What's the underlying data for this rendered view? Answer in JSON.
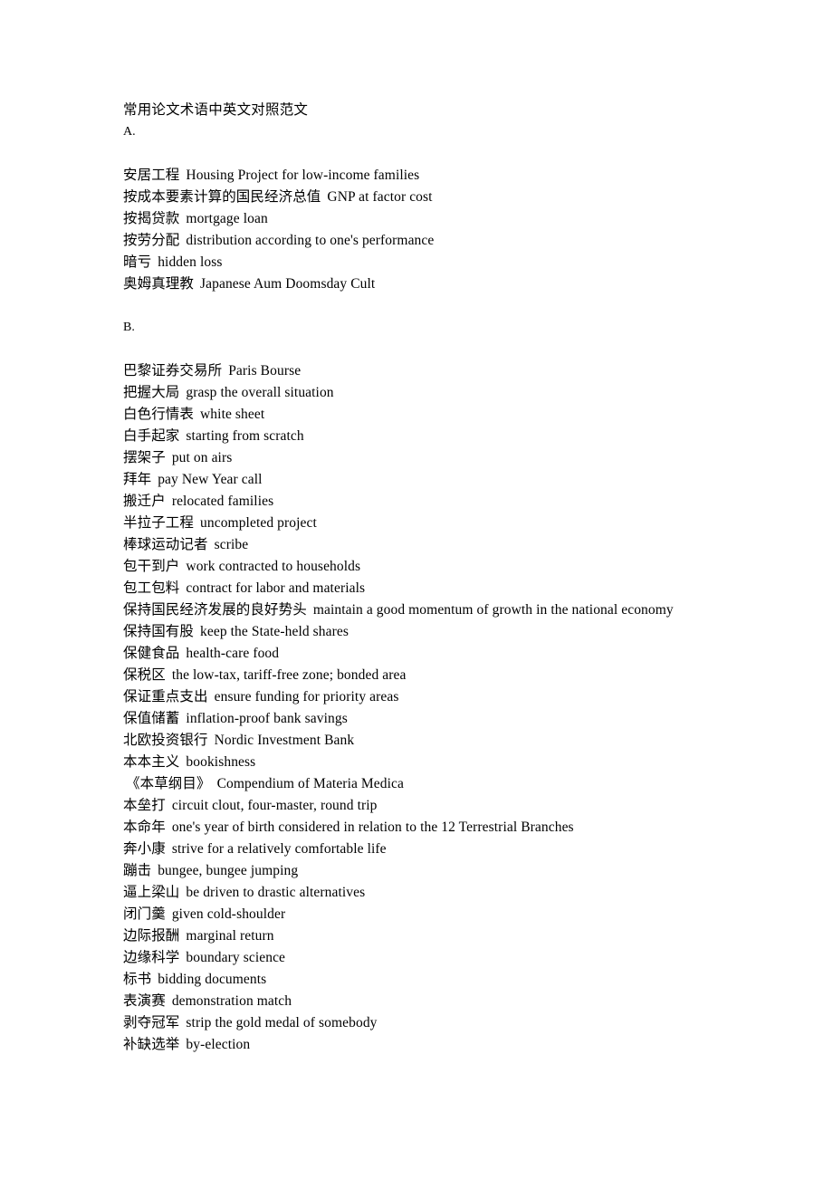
{
  "document": {
    "title": "常用论文术语中英文对照范文",
    "background_color": "#ffffff",
    "text_color": "#000000"
  },
  "sections": [
    {
      "letter": "A.",
      "entries": [
        {
          "term": "安居工程",
          "gloss": "Housing Project for low-income families"
        },
        {
          "term": "按成本要素计算的国民经济总值",
          "gloss": "GNP at factor cost"
        },
        {
          "term": "按揭贷款",
          "gloss": "mortgage loan"
        },
        {
          "term": "按劳分配",
          "gloss": "distribution according to one's performance"
        },
        {
          "term": "暗亏",
          "gloss": "hidden loss"
        },
        {
          "term": "奥姆真理教",
          "gloss": "Japanese Aum Doomsday Cult"
        }
      ]
    },
    {
      "letter": "B.",
      "entries": [
        {
          "term": "巴黎证券交易所",
          "gloss": "Paris Bourse"
        },
        {
          "term": "把握大局",
          "gloss": "grasp the overall situation"
        },
        {
          "term": "白色行情表",
          "gloss": "white sheet"
        },
        {
          "term": "白手起家",
          "gloss": "starting from scratch"
        },
        {
          "term": "摆架子",
          "gloss": "put on airs"
        },
        {
          "term": "拜年",
          "gloss": "pay New Year call"
        },
        {
          "term": "搬迁户",
          "gloss": "relocated families"
        },
        {
          "term": "半拉子工程",
          "gloss": "uncompleted project"
        },
        {
          "term": "棒球运动记者",
          "gloss": "scribe"
        },
        {
          "term": "包干到户",
          "gloss": "work contracted to households"
        },
        {
          "term": "包工包料",
          "gloss": "contract for labor and materials"
        },
        {
          "term": "保持国民经济发展的良好势头",
          "gloss": "maintain a good momentum of growth in the national economy"
        },
        {
          "term": "保持国有股",
          "gloss": "keep the State-held shares"
        },
        {
          "term": "保健食品",
          "gloss": "health-care food"
        },
        {
          "term": "保税区",
          "gloss": "the low-tax, tariff-free zone; bonded area"
        },
        {
          "term": "保证重点支出",
          "gloss": "ensure funding for priority areas"
        },
        {
          "term": "保值储蓄",
          "gloss": "inflation-proof bank savings"
        },
        {
          "term": "北欧投资银行",
          "gloss": "Nordic Investment Bank"
        },
        {
          "term": "本本主义",
          "gloss": "bookishness"
        },
        {
          "term": "《本草纲目》",
          "gloss": "Compendium of Materia Medica",
          "indented": true
        },
        {
          "term": "本垒打",
          "gloss": "circuit clout, four-master, round trip"
        },
        {
          "term": "本命年",
          "gloss": "one's year of birth considered in relation to the 12 Terrestrial Branches"
        },
        {
          "term": "奔小康",
          "gloss": "strive for a relatively comfortable life"
        },
        {
          "term": "蹦击",
          "gloss": "bungee, bungee jumping"
        },
        {
          "term": "逼上梁山",
          "gloss": "be driven to drastic alternatives"
        },
        {
          "term": "闭门羹",
          "gloss": "given cold-shoulder"
        },
        {
          "term": "边际报酬",
          "gloss": "marginal return"
        },
        {
          "term": "边缘科学",
          "gloss": "boundary science"
        },
        {
          "term": "标书",
          "gloss": "bidding documents"
        },
        {
          "term": "表演赛",
          "gloss": "demonstration match"
        },
        {
          "term": "剥夺冠军",
          "gloss": "strip the gold medal of somebody"
        },
        {
          "term": "补缺选举",
          "gloss": "by-election"
        }
      ]
    }
  ]
}
